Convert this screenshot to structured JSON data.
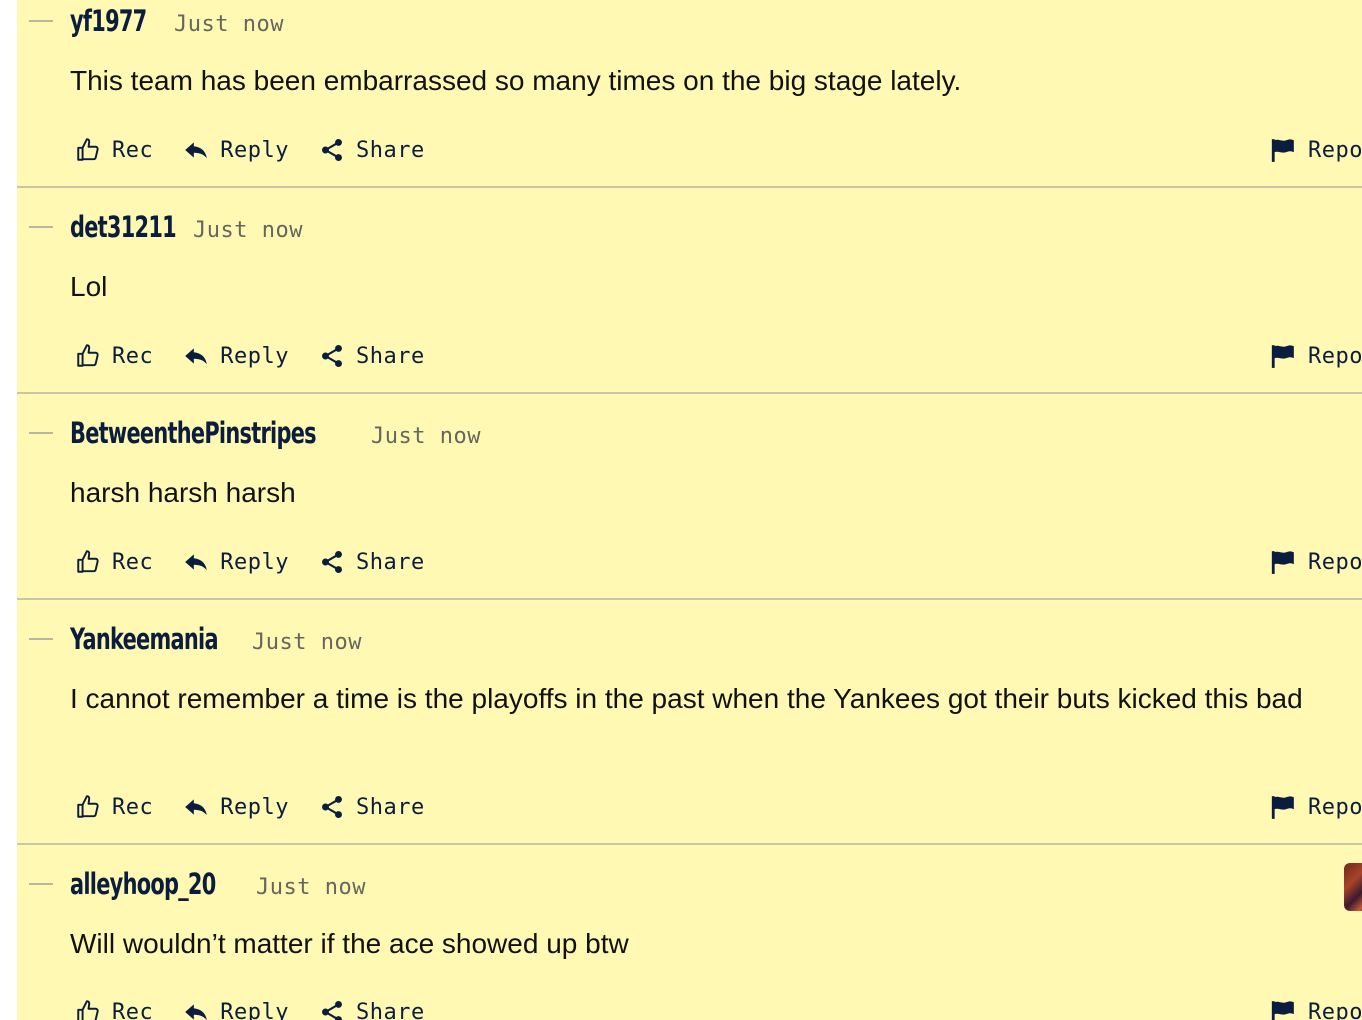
{
  "actions": {
    "rec": "Rec",
    "reply": "Reply",
    "share": "Share",
    "report": "Report"
  },
  "comments": [
    {
      "username": "yf1977",
      "timestamp": "Just now",
      "text": "This team has been embarrassed so many times on the big stage lately."
    },
    {
      "username": "det31211",
      "timestamp": "Just now",
      "text": "Lol"
    },
    {
      "username": "BetweenthePinstripes",
      "timestamp": "Just now",
      "text": "harsh harsh harsh"
    },
    {
      "username": "Yankeemania",
      "timestamp": "Just now",
      "text": "I cannot remember a time is the playoffs in the past when the Yankees got their buts kicked this bad"
    },
    {
      "username": "alleyhoop_20",
      "timestamp": "Just now",
      "text": "Will wouldn’t matter if the ace showed up btw"
    }
  ],
  "colors": {
    "background": "#fff9b3",
    "username": "#0b1d3f",
    "divider": "#c9c6a7",
    "timestamp": "#66665e"
  },
  "icons": {
    "rec": "thumbs-up-icon",
    "reply": "reply-arrow-icon",
    "share": "share-icon",
    "report": "flag-icon"
  }
}
